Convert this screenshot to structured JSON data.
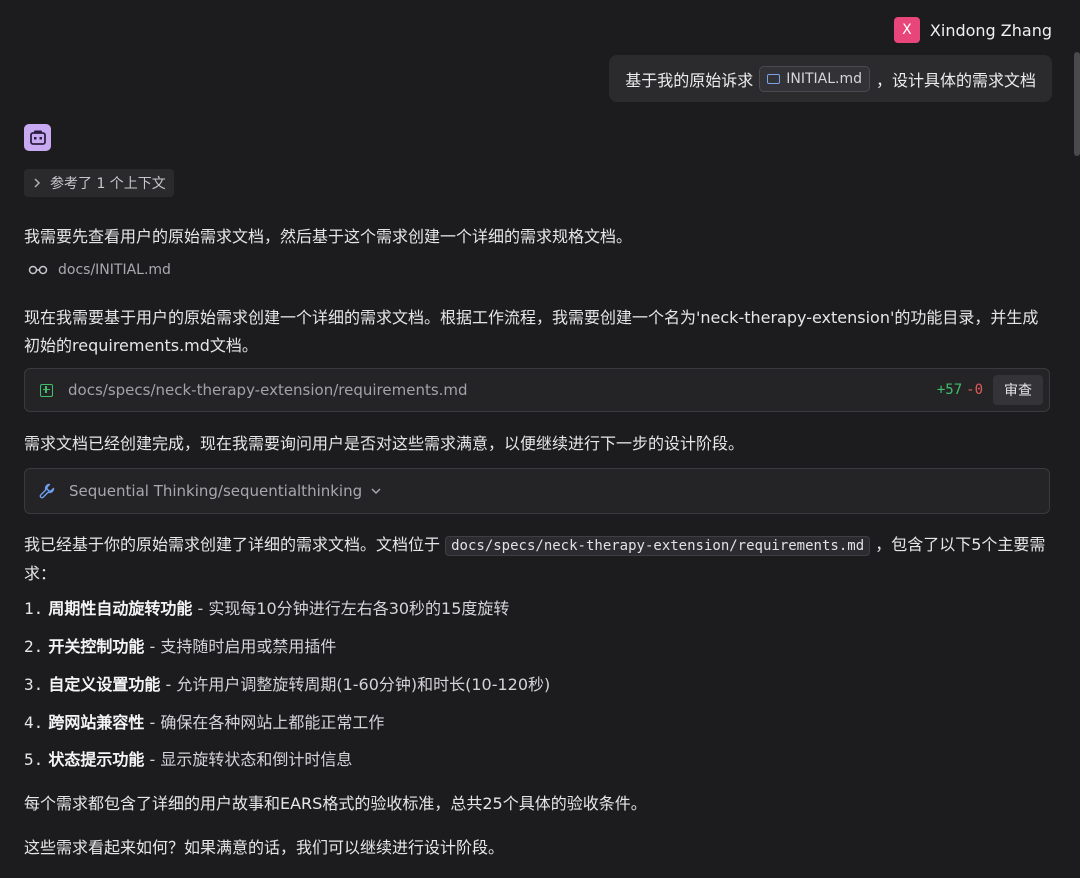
{
  "user": {
    "avatar_letter": "X",
    "name": "Xindong Zhang"
  },
  "user_message": {
    "prefix": "基于我的原始诉求",
    "file_chip": "INITIAL.md",
    "suffix": "，设计具体的需求文档"
  },
  "reference": {
    "label": "参考了 1 个上下文"
  },
  "msg1": "我需要先查看用户的原始需求文档，然后基于这个需求创建一个详细的需求规格文档。",
  "read_file": {
    "path": "docs/INITIAL.md"
  },
  "msg2": "现在我需要基于用户的原始需求创建一个详细的需求文档。根据工作流程，我需要创建一个名为'neck-therapy-extension'的功能目录，并生成初始的requirements.md文档。",
  "file_change": {
    "path": "docs/specs/neck-therapy-extension/requirements.md",
    "additions": "+57",
    "deletions": "-0",
    "review_label": "审查"
  },
  "msg3": "需求文档已经创建完成，现在我需要询问用户是否对这些需求满意，以便继续进行下一步的设计阶段。",
  "tool_call": {
    "label": "Sequential Thinking/sequentialthinking"
  },
  "msg4": {
    "prefix": "我已经基于你的原始需求创建了详细的需求文档。文档位于",
    "code": "docs/specs/neck-therapy-extension/requirements.md",
    "suffix": "，包含了以下5个主要需求："
  },
  "requirements": [
    {
      "num": "1.",
      "title": "周期性自动旋转功能",
      "desc": "- 实现每10分钟进行左右各30秒的15度旋转"
    },
    {
      "num": "2.",
      "title": "开关控制功能",
      "desc": "- 支持随时启用或禁用插件"
    },
    {
      "num": "3.",
      "title": "自定义设置功能",
      "desc": "- 允许用户调整旋转周期(1-60分钟)和时长(10-120秒)"
    },
    {
      "num": "4.",
      "title": "跨网站兼容性",
      "desc": "- 确保在各种网站上都能正常工作"
    },
    {
      "num": "5.",
      "title": "状态提示功能",
      "desc": "- 显示旋转状态和倒计时信息"
    }
  ],
  "msg5": "每个需求都包含了详细的用户故事和EARS格式的验收标准，总共25个具体的验收条件。",
  "msg6": "这些需求看起来如何？如果满意的话，我们可以继续进行设计阶段。",
  "colors": {
    "background": "#1c1c1e",
    "avatar": "#e8457a",
    "bot": "#c8aaf2",
    "add": "#3fbf6a",
    "del": "#e05a5a"
  },
  "icons": [
    "bot-icon",
    "chevron-right-icon",
    "glasses-icon",
    "file-plus-icon",
    "wrench-icon",
    "chevron-down-icon",
    "markdown-icon"
  ]
}
